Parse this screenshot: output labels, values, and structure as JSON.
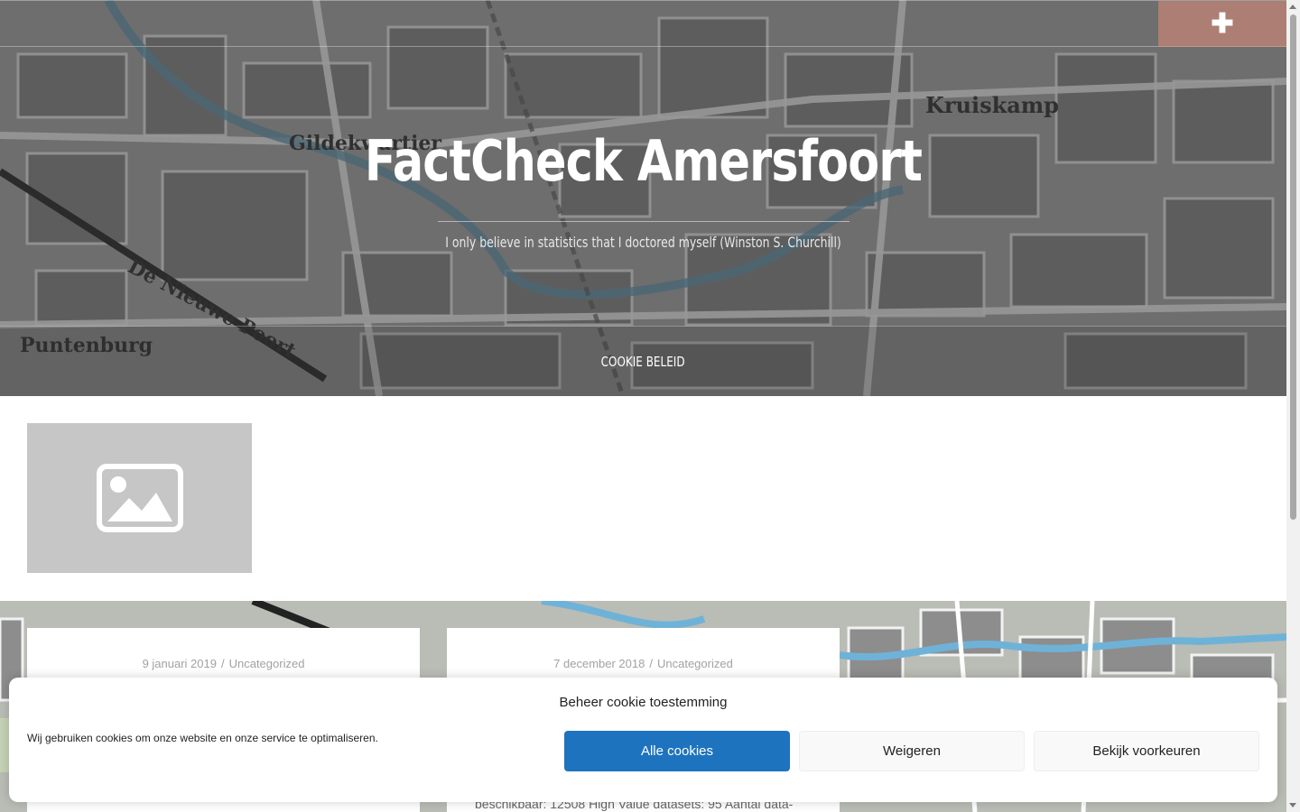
{
  "header": {
    "plus_icon": "plus-icon",
    "site_title": "FactCheck Amersfoort",
    "tagline": "I only believe in statistics that I doctored myself (Winston S. Churchill)",
    "map_labels": [
      "Gildekwartier",
      "Kruiskamp",
      "De Nieuwe Poort",
      "Puntenburg"
    ]
  },
  "nav": {
    "items": [
      {
        "label": "COOKIE BELEID"
      }
    ]
  },
  "placeholder": {
    "icon": "image-placeholder-icon"
  },
  "posts": [
    {
      "date": "9 januari 2019",
      "category": "Uncategorized",
      "excerpt": ""
    },
    {
      "date": "7 december 2018",
      "category": "Uncategorized",
      "excerpt": "beschikbaar: 12508 High Value datasets: 95 Aantal data-"
    }
  ],
  "cookie": {
    "title": "Beheer cookie toestemming",
    "message": "Wij gebruiken cookies om onze website en onze service te optimaliseren.",
    "accept_label": "Alle cookies",
    "deny_label": "Weigeren",
    "prefs_label": "Bekijk voorkeuren"
  },
  "colors": {
    "accent": "#1e73be",
    "plus_button": "#e18c78",
    "placeholder_bg": "#c6c6c6"
  }
}
